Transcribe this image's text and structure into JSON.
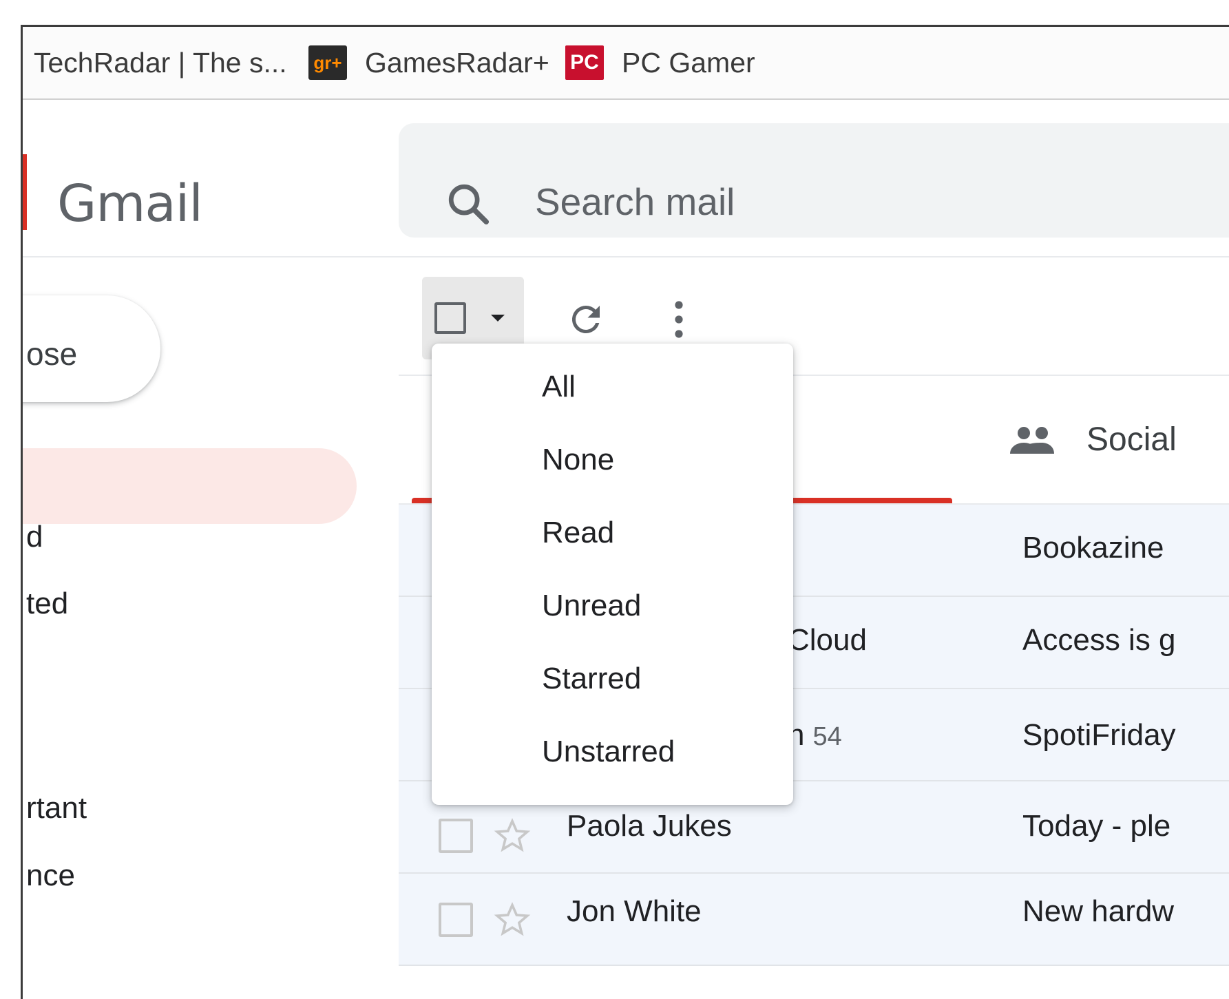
{
  "bookmarks": [
    {
      "label": "TechRadar | The s...",
      "icon": "techradar-favicon"
    },
    {
      "label": "GamesRadar+",
      "icon": "gamesradar-favicon",
      "icon_text": "gr+"
    },
    {
      "label": "PC Gamer",
      "icon": "pcgamer-favicon",
      "icon_text": "PC"
    }
  ],
  "header": {
    "app_title": "Gmail",
    "search_placeholder": "Search mail"
  },
  "sidebar": {
    "compose_label": "ose",
    "items": [
      {
        "label": "d"
      },
      {
        "label": "ted"
      },
      {
        "label": "rtant"
      },
      {
        "label": "nce"
      }
    ]
  },
  "toolbar": {
    "select_icon": "checkbox-icon",
    "caret_icon": "chevron-down-icon",
    "refresh_icon": "refresh-icon",
    "more_icon": "more-vertical-icon"
  },
  "tabs": {
    "social_label": "Social"
  },
  "select_menu": {
    "items": [
      "All",
      "None",
      "Read",
      "Unread",
      "Starred",
      "Unstarred"
    ]
  },
  "emails": [
    {
      "sender": "",
      "count": "",
      "subject": "Bookazine"
    },
    {
      "sender": "Cloud",
      "count": "",
      "subject": "Access is g"
    },
    {
      "sender": "n",
      "count": "54",
      "subject": "SpotiFriday"
    },
    {
      "sender": "Paola Jukes",
      "count": "",
      "subject": "Today - ple"
    },
    {
      "sender": "Jon White",
      "count": "",
      "subject": "New hardw"
    }
  ],
  "colors": {
    "accent_red": "#d93025",
    "active_nav_bg": "#fce8e6",
    "search_bg": "#f1f3f4"
  }
}
